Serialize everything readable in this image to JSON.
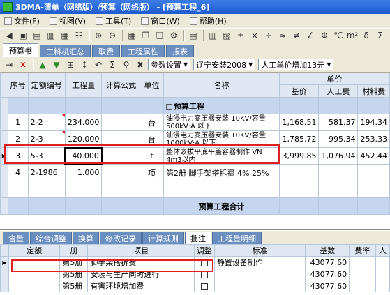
{
  "window": {
    "title": "3DMA-清单（网络版）/预算（网络版） - [预算工程_6]"
  },
  "menu": [
    {
      "label": "文件(F)"
    },
    {
      "label": "视图(V)"
    },
    {
      "label": "工具(T)"
    },
    {
      "label": "窗口(W)"
    },
    {
      "label": "帮助(H)"
    }
  ],
  "toolbar_symbols": [
    "±",
    "×",
    "÷",
    "≈",
    "≠",
    "∠",
    "Φ",
    "℃",
    "m²",
    "δ",
    "Σ"
  ],
  "main_tabs": [
    {
      "label": "预算书",
      "active": true
    },
    {
      "label": "工料机汇总",
      "active": false
    },
    {
      "label": "取费",
      "active": false
    },
    {
      "label": "工程属性",
      "active": false
    },
    {
      "label": "报表",
      "active": false
    }
  ],
  "toolbar2": {
    "settings_label": "参数设置",
    "region_select": "辽宁安装2008",
    "labor_select": "人工单价增加13元"
  },
  "budget_table": {
    "headers": {
      "seq": "序号",
      "code": "定额编号",
      "qty": "工程量",
      "formula": "计算公式",
      "unit": "单位",
      "name": "名称",
      "price_group": "单价",
      "base": "基价",
      "labor": "人工费",
      "material": "材料费"
    },
    "project_row": "预算工程",
    "rows": [
      {
        "seq": "1",
        "code": "2-2",
        "qty": "234.000",
        "formula": "",
        "unit": "台",
        "name": "油浸电力变压器安装 10KV/容量500kV·A 以下",
        "base": "1,168.51",
        "labor": "581.37",
        "material": "194.34"
      },
      {
        "seq": "2",
        "code": "2-3",
        "qty": "120.000",
        "formula": "",
        "unit": "台",
        "name": "油浸电力变压器安装 10KV/容量1000kV·A 以下",
        "base": "1,785.72",
        "labor": "995.34",
        "material": "253.33"
      },
      {
        "seq": "3",
        "code": "5-3",
        "qty": "40.000",
        "formula": "",
        "unit": "t",
        "name": "整体嵌拔平底平盖容器制作 VN 4m3以内",
        "base": "3,999.85",
        "labor": "1,076.94",
        "material": "452.44"
      },
      {
        "seq": "4",
        "code": "2-1986",
        "qty": "1.000",
        "formula": "",
        "unit": "项",
        "name": "第2册 脚手架搭拆费 4% 25%",
        "base": "",
        "labor": "",
        "material": ""
      }
    ],
    "total_label": "预算工程合计"
  },
  "bottom_tabs": [
    {
      "label": "含量",
      "active": false
    },
    {
      "label": "综合调整",
      "active": false
    },
    {
      "label": "换算",
      "active": false
    },
    {
      "label": "修改记录",
      "active": false
    },
    {
      "label": "计算规则",
      "active": false
    },
    {
      "label": "批注",
      "active": true
    },
    {
      "label": "工程量明细",
      "active": false
    }
  ],
  "adjust_table": {
    "headers": {
      "quota": "定额",
      "book": "册",
      "item": "项目",
      "adjust": "调整",
      "standard": "标准",
      "base": "基数",
      "rate": "费率",
      "extra": "人"
    },
    "rows": [
      {
        "quota": "",
        "book": "第5册",
        "item": "脚手架搭拆费",
        "adjust": false,
        "standard": "静置设备制作",
        "base": "43077.60"
      },
      {
        "quota": "",
        "book": "第5册",
        "item": "安装与生产同时进行",
        "adjust": false,
        "standard": "",
        "base": "43077.60"
      },
      {
        "quota": "",
        "book": "第5册",
        "item": "有害环境增加费",
        "adjust": false,
        "standard": "",
        "base": "43077.60"
      }
    ]
  }
}
